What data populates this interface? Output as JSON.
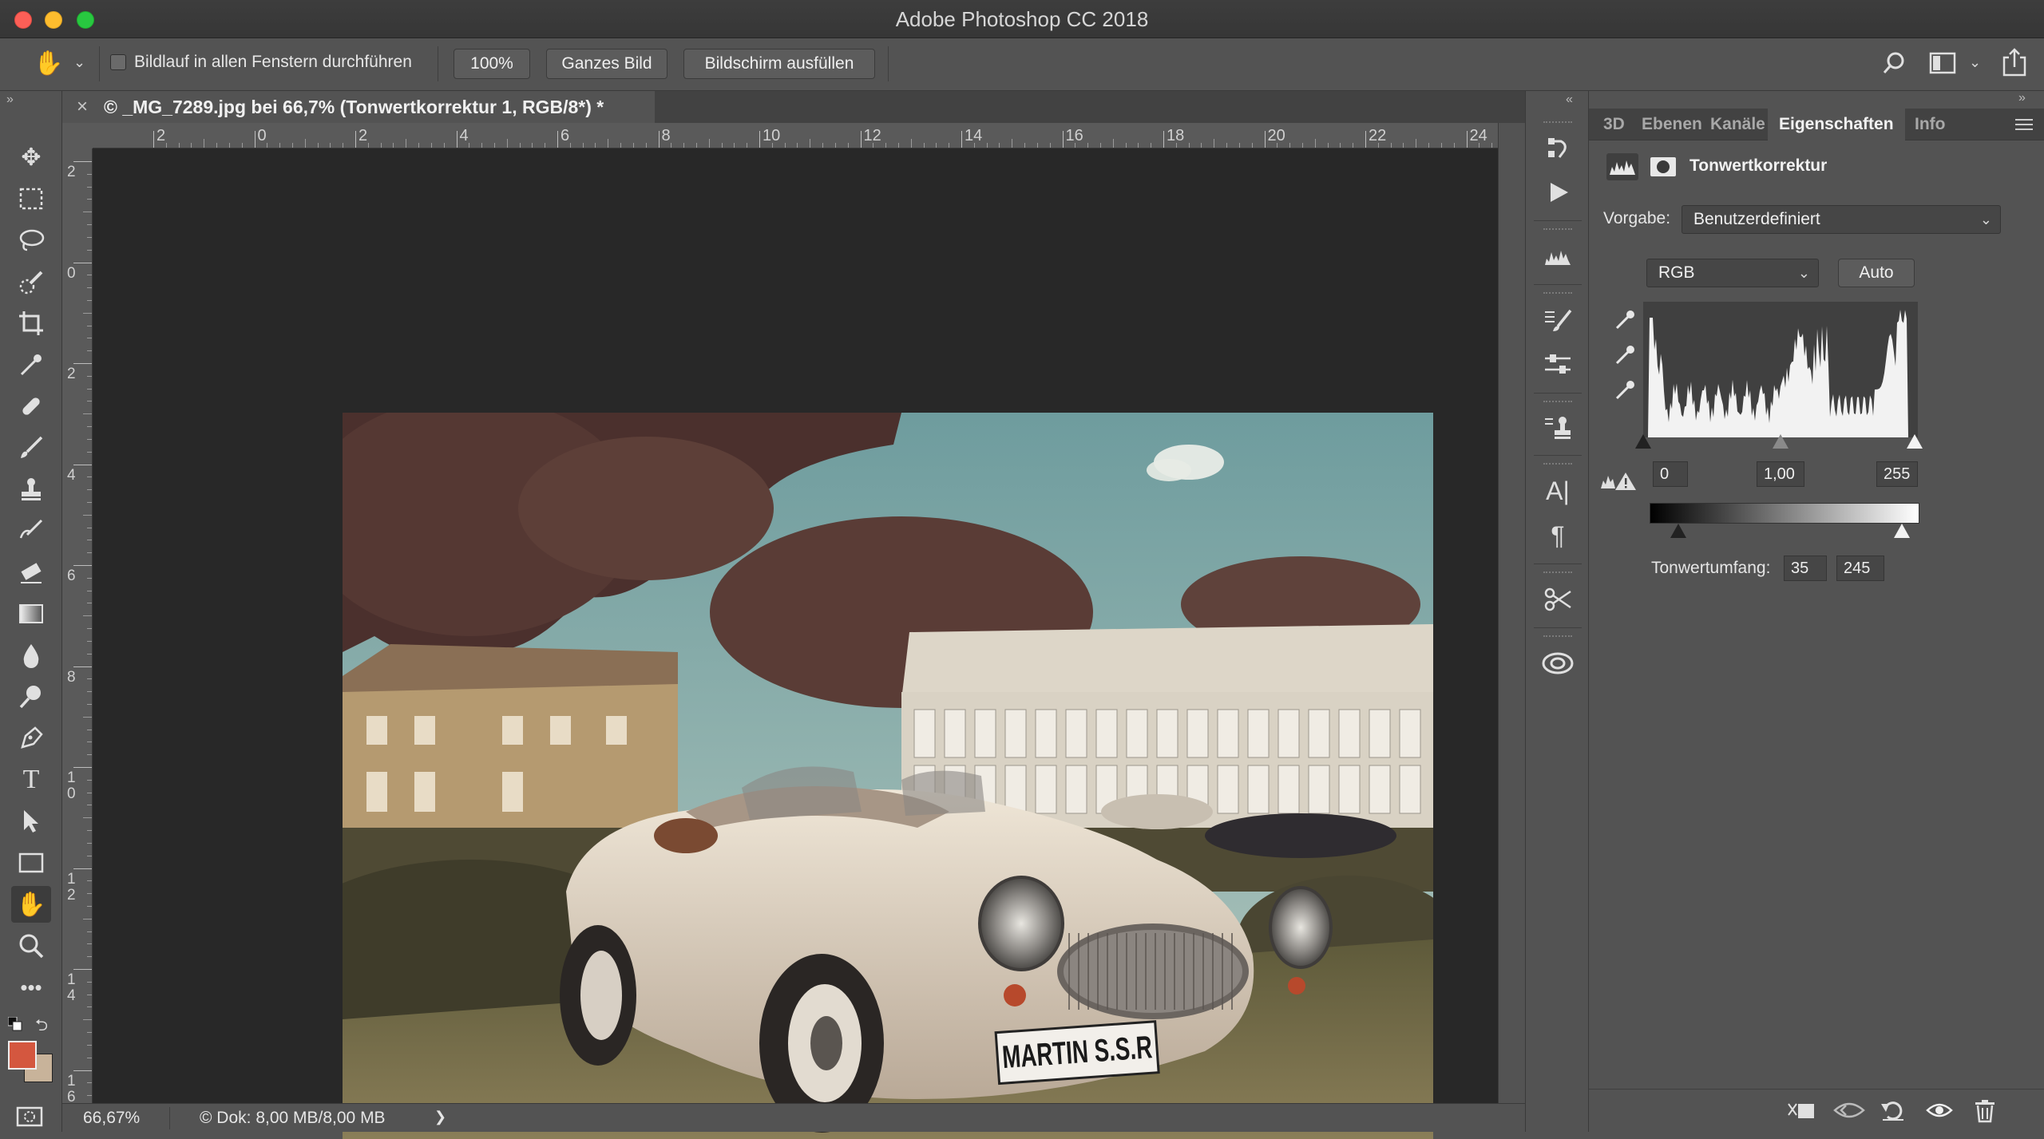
{
  "window": {
    "title": "Adobe Photoshop CC 2018"
  },
  "options_bar": {
    "scroll_all_windows_label": "Bildlauf in allen Fenstern durchführen",
    "zoom_100_label": "100%",
    "fit_screen_label": "Ganzes Bild",
    "fill_screen_label": "Bildschirm ausfüllen"
  },
  "document": {
    "tab_title": "© _MG_7289.jpg bei 66,7% (Tonwertkorrektur 1, RGB/8*) *",
    "close_glyph": "×",
    "ruler_h_labels": [
      "2",
      "0",
      "2",
      "4",
      "6",
      "8",
      "10",
      "12",
      "14",
      "16",
      "18",
      "20",
      "22",
      "24"
    ],
    "ruler_v_labels": [
      "2",
      "0",
      "2",
      "4",
      "6",
      "8",
      "1\n0",
      "1\n2",
      "1\n4",
      "1\n6"
    ],
    "plate_text": "MARTIN S.S.R"
  },
  "status_bar": {
    "zoom": "66,67%",
    "doc_size": "© Dok: 8,00 MB/8,00 MB",
    "arrow": "❯"
  },
  "panel": {
    "tabs": [
      "3D",
      "Ebenen",
      "Kanäle",
      "Eigenschaften",
      "Info"
    ],
    "active_tab": "Eigenschaften",
    "title": "Tonwertkorrektur",
    "preset_label": "Vorgabe:",
    "preset_value": "Benutzerdefiniert",
    "channel_value": "RGB",
    "auto_label": "Auto",
    "input_black": "0",
    "input_gamma": "1,00",
    "input_white": "255",
    "output_label": "Tonwertumfang:",
    "output_black": "35",
    "output_white": "245"
  },
  "colors": {
    "foreground": "#d4573f",
    "background": "#c8b39a",
    "panel_bg": "#535353",
    "canvas_bg": "#282828"
  },
  "icons": [
    "hand-icon",
    "move-icon",
    "marquee-icon",
    "lasso-icon",
    "quick-select-icon",
    "crop-icon",
    "eyedropper-icon",
    "healing-icon",
    "brush-icon",
    "stamp-icon",
    "history-brush-icon",
    "eraser-icon",
    "gradient-icon",
    "blur-icon",
    "dodge-icon",
    "pen-icon",
    "type-icon",
    "path-select-icon",
    "rectangle-icon",
    "zoom-icon",
    "search-icon",
    "workspace-icon",
    "share-icon"
  ]
}
